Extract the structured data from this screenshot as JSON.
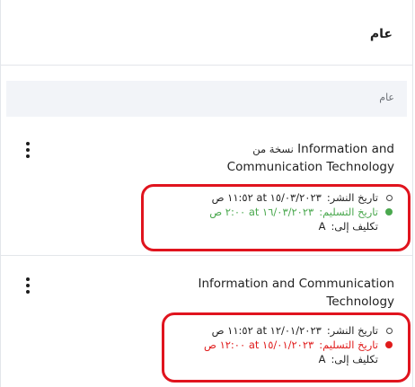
{
  "header": {
    "title": "عام"
  },
  "section": {
    "label": "عام"
  },
  "cards": [
    {
      "title_prefix": "نسخة من",
      "title": "Information and Communication Technology",
      "published_label": "تاريخ النشر:",
      "published_value": "١٥/٠٣/٢٠٢٣ at ١١:٥٢ ص",
      "due_label": "تاريخ التسليم:",
      "due_value": "١٦/٠٣/٢٠٢٣ at ٢:٠٠ ص",
      "due_status_color": "#4aa84e",
      "assign_label": "تكليف إلى:",
      "assign_value": "A"
    },
    {
      "title_prefix": "",
      "title": "Information and Communication Technology",
      "published_label": "تاريخ النشر:",
      "published_value": "١٢/٠١/٢٠٢٣ at ١١:٥٢ ص",
      "due_label": "تاريخ التسليم:",
      "due_value": "١٥/٠١/٢٠٢٣ at ١٢:٠٠ ص",
      "due_status_color": "#e01b1b",
      "assign_label": "تكليف إلى:",
      "assign_value": "A"
    }
  ],
  "icons": {
    "published": "clock-icon",
    "due": "status-dot-icon",
    "menu": "more-vertical-icon"
  },
  "colors": {
    "highlight": "#e0141e",
    "section_bg": "#f2f4f8"
  }
}
